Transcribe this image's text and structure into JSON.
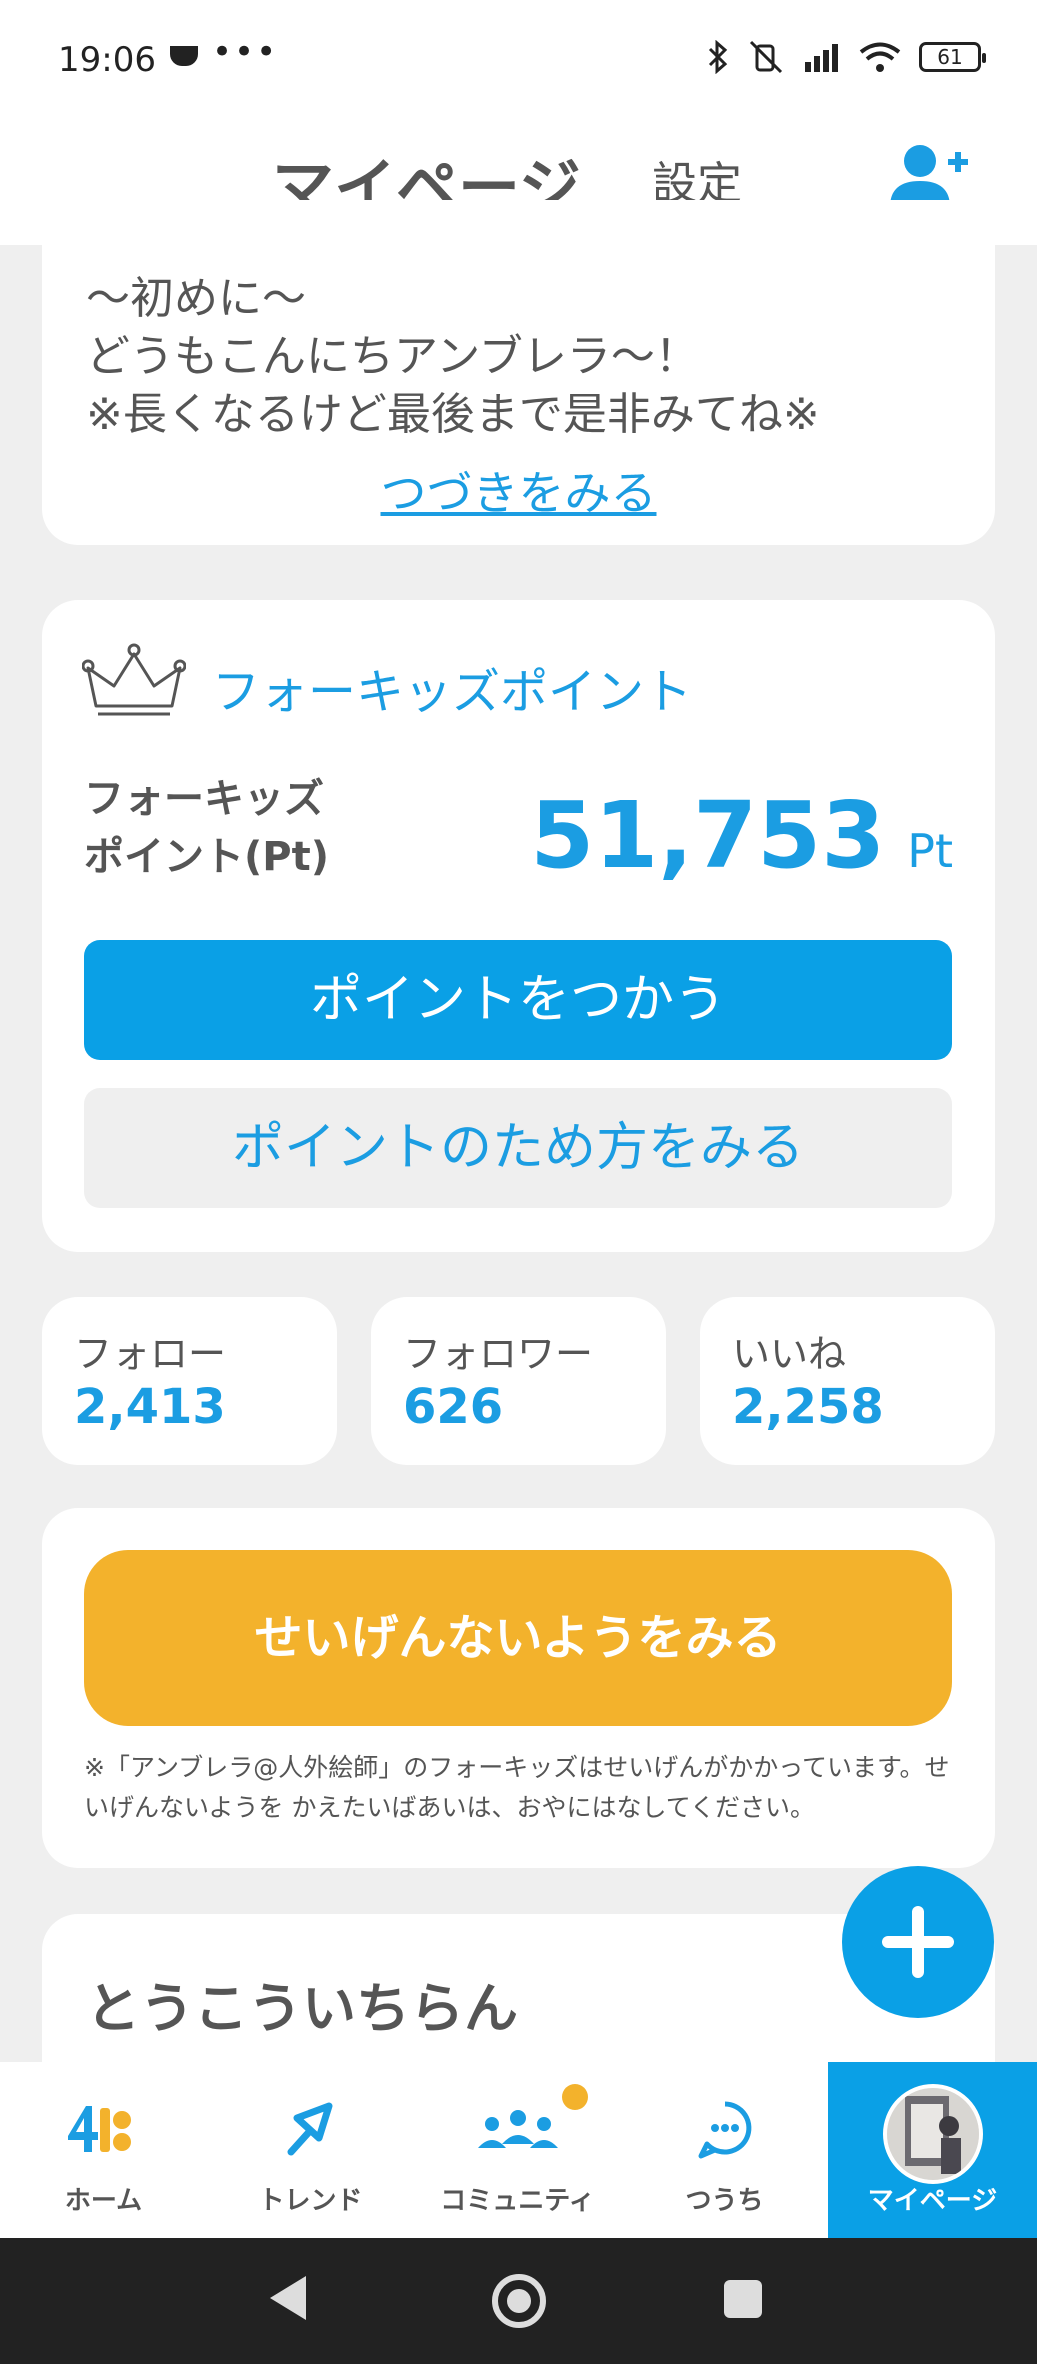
{
  "status_bar": {
    "time": "19:06",
    "dots": "•••",
    "battery": "61"
  },
  "header": {
    "title": "マイページ",
    "settings": "設定",
    "icon": "add-user-icon"
  },
  "bio": {
    "lines": [
      "〜初めに〜",
      "どうもこんにちアンブレラ〜！",
      "※長くなるけど最後まで是非みてね※"
    ],
    "more": "つづきをみる"
  },
  "points": {
    "heading": "フォーキッズポイント",
    "label_line1": "フォーキッズ",
    "label_line2": "ポイント(Pt)",
    "value": "51,753",
    "unit": "Pt",
    "use_button": "ポイントをつかう",
    "howto_button": "ポイントのため方をみる"
  },
  "stats": [
    {
      "label": "フォロー",
      "value": "2,413"
    },
    {
      "label": "フォロワー",
      "value": "626"
    },
    {
      "label": "いいね",
      "value": "2,258"
    }
  ],
  "limits": {
    "button": "せいげんないようをみる",
    "note": "※「アンブレラ@人外絵師」のフォーキッズはせいげんがかかっています。せいげんないようを かえたいばあいは、おやにはなしてください。"
  },
  "posts": {
    "title": "とうこういちらん"
  },
  "nav": [
    {
      "label": "ホーム",
      "icon": "home-icon"
    },
    {
      "label": "トレンド",
      "icon": "trend-icon"
    },
    {
      "label": "コミュニティ",
      "icon": "community-icon"
    },
    {
      "label": "つうち",
      "icon": "notification-icon"
    },
    {
      "label": "マイページ",
      "icon": "avatar"
    }
  ],
  "colors": {
    "accent": "#0aa0e6",
    "text_blue": "#1b9de2",
    "yellow": "#f3b22c",
    "background": "#efefef"
  }
}
